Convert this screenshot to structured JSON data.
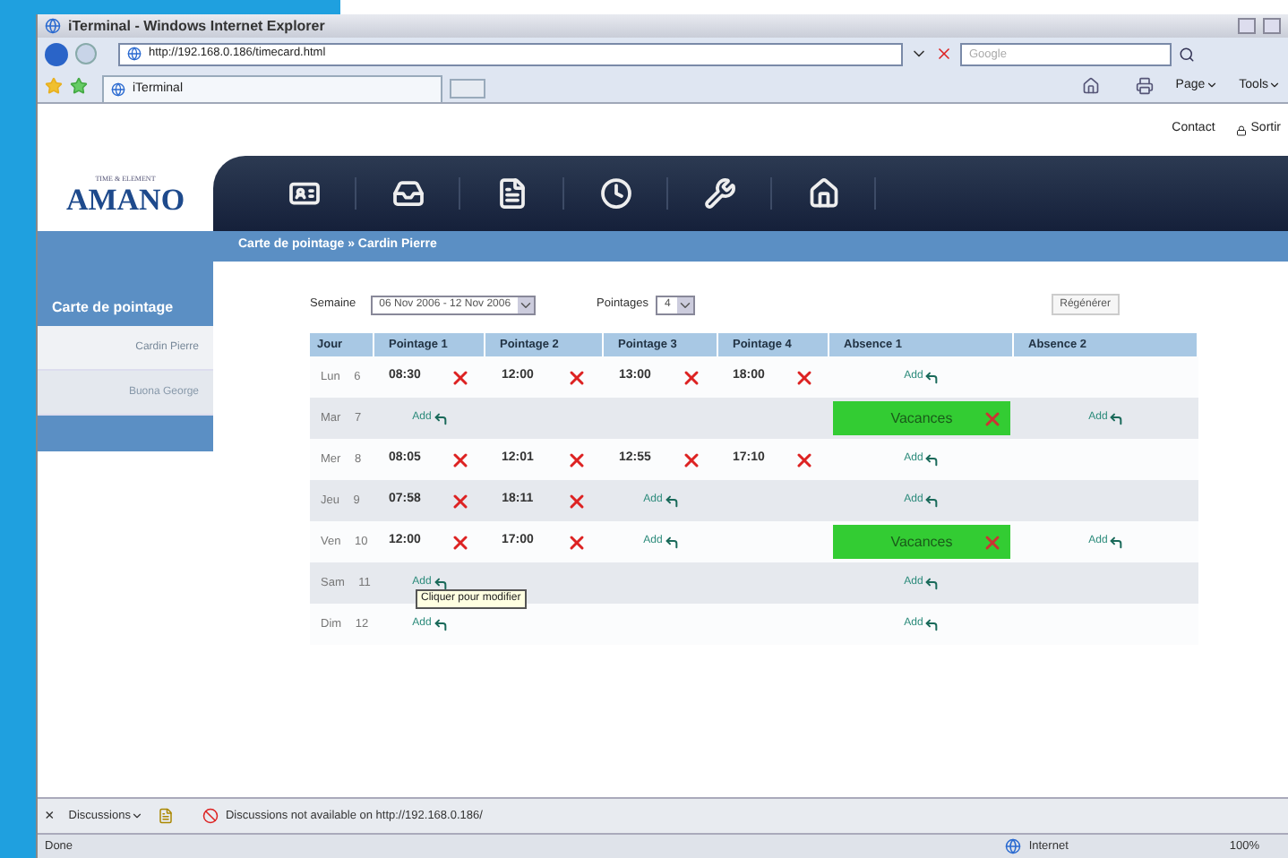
{
  "window": {
    "title": "iTerminal - Windows Internet Explorer"
  },
  "address_bar": {
    "url": "http://192.168.0.186/timecard.html",
    "search_placeholder": "Google"
  },
  "tab_bar": {
    "tab": "iTerminal",
    "tools": [
      "Page",
      "Tools"
    ]
  },
  "top_links": [
    "Contact",
    "Sortir"
  ],
  "logo": {
    "tagline": "TIME & ELEMENT",
    "name": "AMANO"
  },
  "breadcrumb": "Carte de pointage » Cardin Pierre",
  "sidebar": {
    "title": "Carte de pointage",
    "items": [
      {
        "label": "Cardin Pierre",
        "selected": true
      },
      {
        "label": "Buona George",
        "selected": false
      }
    ]
  },
  "filters": {
    "week_label": "Semaine",
    "week_value": "06 Nov 2006 - 12 Nov 2006",
    "count_label": "Pointages",
    "count_value": "4",
    "regenerate": "Régénérer"
  },
  "table": {
    "columns": [
      "Jour",
      "Pointage 1",
      "Pointage 2",
      "Pointage 3",
      "Pointage 4",
      "Absence 1",
      "Absence 2"
    ],
    "rows": [
      {
        "cells": [
          {
            "kind": "day",
            "text": "Lun 6"
          },
          {
            "kind": "time",
            "text": "08:30"
          },
          {
            "kind": "time",
            "text": "12:00"
          },
          {
            "kind": "time",
            "text": "13:00"
          },
          {
            "kind": "time",
            "text": "18:00"
          },
          {
            "kind": "add",
            "text": "Add"
          },
          {
            "kind": "empty"
          }
        ]
      },
      {
        "cells": [
          {
            "kind": "day",
            "text": "Mar 7"
          },
          {
            "kind": "add",
            "text": "Add"
          },
          {
            "kind": "empty"
          },
          {
            "kind": "empty"
          },
          {
            "kind": "empty"
          },
          {
            "kind": "absence",
            "text": "Vacances",
            "color": "#33cc33"
          },
          {
            "kind": "add",
            "text": "Add"
          }
        ]
      },
      {
        "cells": [
          {
            "kind": "day",
            "text": "Mer 8"
          },
          {
            "kind": "time",
            "text": "08:05"
          },
          {
            "kind": "time",
            "text": "12:01"
          },
          {
            "kind": "time",
            "text": "12:55"
          },
          {
            "kind": "time",
            "text": "17:10"
          },
          {
            "kind": "add",
            "text": "Add"
          },
          {
            "kind": "empty"
          }
        ]
      },
      {
        "cells": [
          {
            "kind": "day",
            "text": "Jeu 9"
          },
          {
            "kind": "time",
            "text": "07:58"
          },
          {
            "kind": "time",
            "text": "18:11"
          },
          {
            "kind": "add",
            "text": "Add"
          },
          {
            "kind": "empty"
          },
          {
            "kind": "add",
            "text": "Add"
          },
          {
            "kind": "empty"
          }
        ]
      },
      {
        "cells": [
          {
            "kind": "day",
            "text": "Ven 10"
          },
          {
            "kind": "time",
            "text": "12:00"
          },
          {
            "kind": "time",
            "text": "17:00"
          },
          {
            "kind": "add",
            "text": "Add"
          },
          {
            "kind": "empty"
          },
          {
            "kind": "absence",
            "text": "Vacances",
            "color": "#33cc33"
          },
          {
            "kind": "add",
            "text": "Add"
          }
        ]
      },
      {
        "cells": [
          {
            "kind": "day",
            "text": "Sam 11"
          },
          {
            "kind": "add",
            "text": "Add"
          },
          {
            "kind": "empty"
          },
          {
            "kind": "empty"
          },
          {
            "kind": "empty"
          },
          {
            "kind": "add",
            "text": "Add"
          },
          {
            "kind": "empty"
          }
        ]
      },
      {
        "cells": [
          {
            "kind": "day",
            "text": "Dim 12"
          },
          {
            "kind": "add",
            "text": "Add"
          },
          {
            "kind": "empty"
          },
          {
            "kind": "empty"
          },
          {
            "kind": "empty"
          },
          {
            "kind": "add",
            "text": "Add"
          },
          {
            "kind": "empty"
          }
        ]
      }
    ]
  },
  "tooltip": "Cliquer pour modifier",
  "discussions_bar": {
    "close": "×",
    "menu": "Discussions",
    "message": "Discussions not available on http://192.168.0.186/"
  },
  "status_bar": {
    "status": "Done",
    "zone": "Internet",
    "zoom": "100%"
  }
}
